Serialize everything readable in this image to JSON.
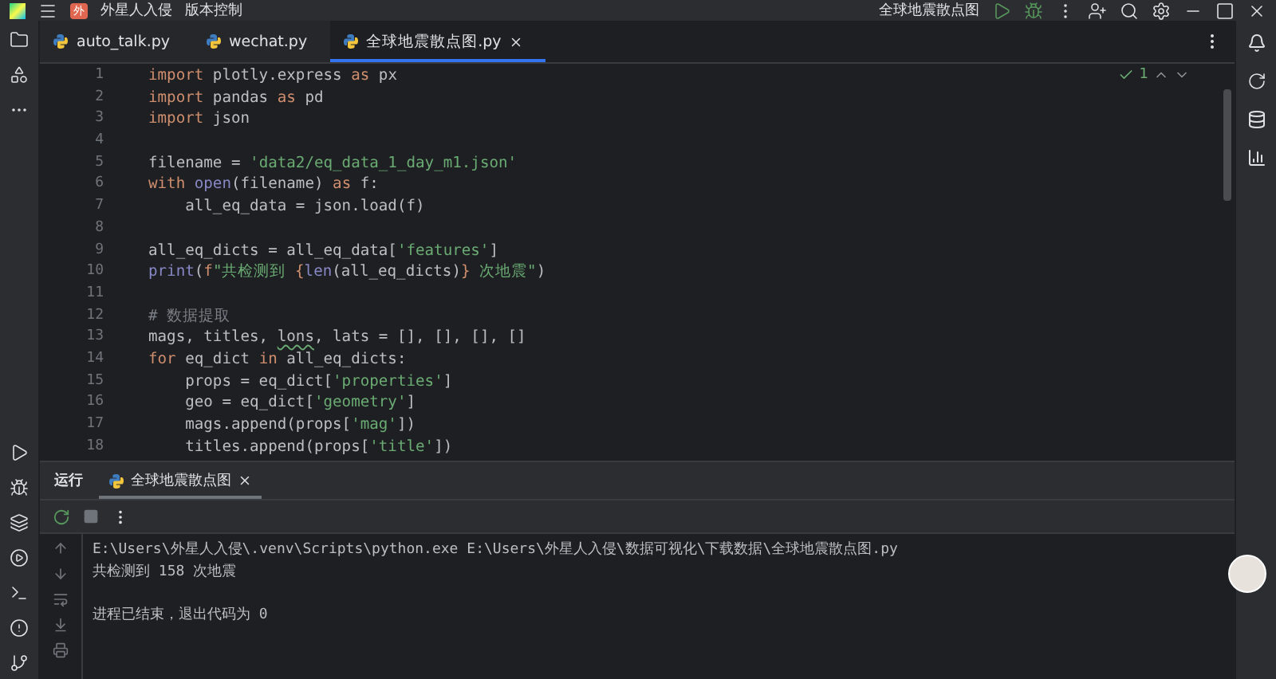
{
  "title_bar": {
    "project": "外星人入侵",
    "project_badge": "外",
    "vcs": "版本控制",
    "run_config": "全球地震散点图"
  },
  "editor_tabs": [
    {
      "label": "auto_talk.py",
      "selected": false
    },
    {
      "label": "wechat.py",
      "selected": false
    },
    {
      "label": "全球地震散点图.py",
      "selected": true
    }
  ],
  "inspection": {
    "count": "1"
  },
  "code_lines": [
    {
      "number": "1",
      "tokens": [
        {
          "kind": "keyword",
          "text": "import"
        },
        {
          "kind": "plain",
          "text": " plotly.express "
        },
        {
          "kind": "keyword",
          "text": "as"
        },
        {
          "kind": "plain",
          "text": " px"
        }
      ]
    },
    {
      "number": "2",
      "tokens": [
        {
          "kind": "keyword",
          "text": "import"
        },
        {
          "kind": "plain",
          "text": " pandas "
        },
        {
          "kind": "keyword",
          "text": "as"
        },
        {
          "kind": "plain",
          "text": " pd"
        }
      ]
    },
    {
      "number": "3",
      "tokens": [
        {
          "kind": "keyword",
          "text": "import"
        },
        {
          "kind": "plain",
          "text": " json"
        }
      ]
    },
    {
      "number": "4"
    },
    {
      "number": "5",
      "tokens": [
        {
          "kind": "plain",
          "text": "filename = "
        },
        {
          "kind": "string",
          "text": "'data2/eq_data_1_day_m1.json'"
        }
      ]
    },
    {
      "number": "6",
      "tokens": [
        {
          "kind": "keyword",
          "text": "with"
        },
        {
          "kind": "builtin",
          "text": " open"
        },
        {
          "kind": "plain",
          "text": "(filename) "
        },
        {
          "kind": "keyword",
          "text": "as"
        },
        {
          "kind": "plain",
          "text": " f:"
        }
      ]
    },
    {
      "number": "7",
      "tokens": [
        {
          "kind": "plain",
          "text": "    all_eq_data = json.load(f)"
        }
      ]
    },
    {
      "number": "8"
    },
    {
      "number": "9",
      "tokens": [
        {
          "kind": "plain",
          "text": "all_eq_dicts = all_eq_data["
        },
        {
          "kind": "string",
          "text": "'features'"
        },
        {
          "kind": "plain",
          "text": "]"
        }
      ]
    },
    {
      "number": "10",
      "tokens": [
        {
          "kind": "builtin",
          "text": "print"
        },
        {
          "kind": "plain",
          "text": "("
        },
        {
          "kind": "keyword",
          "text": "f"
        },
        {
          "kind": "string",
          "text": "\"共检测到 "
        },
        {
          "kind": "brace",
          "text": "{"
        },
        {
          "kind": "builtin",
          "text": "len"
        },
        {
          "kind": "plain",
          "text": "(all_eq_dicts)"
        },
        {
          "kind": "brace",
          "text": "}"
        },
        {
          "kind": "string",
          "text": " 次地震\""
        },
        {
          "kind": "plain",
          "text": ")"
        }
      ]
    },
    {
      "number": "11"
    },
    {
      "number": "12",
      "tokens": [
        {
          "kind": "comment",
          "text": "# 数据提取"
        }
      ]
    },
    {
      "number": "13",
      "tokens": [
        {
          "kind": "plain",
          "text": "mags, titles, "
        },
        {
          "kind": "warning",
          "text": "lons"
        },
        {
          "kind": "plain",
          "text": ", lats = [], [], [], []"
        }
      ]
    },
    {
      "number": "14",
      "tokens": [
        {
          "kind": "keyword",
          "text": "for"
        },
        {
          "kind": "plain",
          "text": " eq_dict "
        },
        {
          "kind": "keyword",
          "text": "in"
        },
        {
          "kind": "plain",
          "text": " all_eq_dicts:"
        }
      ]
    },
    {
      "number": "15",
      "tokens": [
        {
          "kind": "plain",
          "text": "    props = eq_dict["
        },
        {
          "kind": "string",
          "text": "'properties'"
        },
        {
          "kind": "plain",
          "text": "]"
        }
      ]
    },
    {
      "number": "16",
      "tokens": [
        {
          "kind": "plain",
          "text": "    geo = eq_dict["
        },
        {
          "kind": "string",
          "text": "'geometry'"
        },
        {
          "kind": "plain",
          "text": "]"
        }
      ]
    },
    {
      "number": "17",
      "tokens": [
        {
          "kind": "plain",
          "text": "    mags.append(props["
        },
        {
          "kind": "string",
          "text": "'mag'"
        },
        {
          "kind": "plain",
          "text": "])"
        }
      ]
    },
    {
      "number": "18",
      "tokens": [
        {
          "kind": "plain",
          "text": "    titles.append(props["
        },
        {
          "kind": "string",
          "text": "'title'"
        },
        {
          "kind": "plain",
          "text": "])"
        }
      ]
    }
  ],
  "run_panel": {
    "title": "运行",
    "tabs": [
      {
        "label": "全球地震散点图",
        "selected": true
      }
    ]
  },
  "console_blocks": [
    {
      "lines": [
        "E:\\Users\\外星人入侵\\.venv\\Scripts\\python.exe E:\\Users\\外星人入侵\\数据可视化\\下载数据\\全球地震散点图.py",
        "共检测到 158 次地震"
      ]
    },
    {
      "lines": [
        "进程已结束，退出代码为 0"
      ]
    }
  ]
}
